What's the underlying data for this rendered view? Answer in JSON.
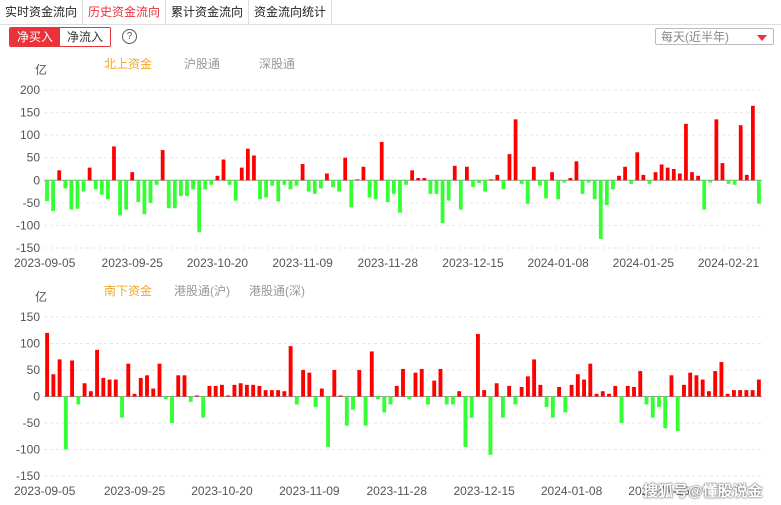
{
  "tabs": [
    "实时资金流向",
    "历史资金流向",
    "累计资金流向",
    "资金流向统计"
  ],
  "active_tab": 1,
  "toggle": {
    "on": "净买入",
    "off": "净流入"
  },
  "help_label": "?",
  "period_select": "每天(近半年)",
  "watermark": "搜狐号@懂股说金",
  "colors": {
    "positive": "#ff0000",
    "negative": "#33ff33",
    "active_legend": "#f5a623",
    "inactive_legend": "#999999",
    "tab_active": "#e8333a"
  },
  "chart_data": [
    {
      "type": "bar",
      "unit_label": "亿",
      "legend": [
        "北上资金",
        "沪股通",
        "深股通"
      ],
      "legend_active": 0,
      "ylim": [
        -150,
        200
      ],
      "yticks": [
        -150,
        -100,
        -50,
        0,
        50,
        100,
        150,
        200
      ],
      "xtick_labels": [
        "2023-09-05",
        "2023-09-25",
        "2023-10-20",
        "2023-11-09",
        "2023-11-28",
        "2023-12-15",
        "2024-01-08",
        "2024-01-25",
        "2024-02-21"
      ],
      "xtick_positions": [
        0,
        14,
        28,
        42,
        56,
        70,
        84,
        98,
        112
      ],
      "values": [
        -46,
        -68,
        22,
        -18,
        -65,
        -63,
        -25,
        28,
        -20,
        -32,
        -42,
        75,
        -78,
        -65,
        18,
        -48,
        -75,
        -50,
        -10,
        67,
        -62,
        -62,
        -35,
        -35,
        -20,
        -115,
        -20,
        -10,
        10,
        46,
        -10,
        -45,
        28,
        70,
        55,
        -42,
        -38,
        -12,
        -47,
        -10,
        -20,
        -12,
        36,
        -25,
        -30,
        -18,
        15,
        -15,
        -25,
        50,
        -60,
        2,
        30,
        -38,
        -42,
        85,
        -48,
        -30,
        -72,
        -10,
        22,
        5,
        5,
        -30,
        -30,
        -95,
        -45,
        32,
        -65,
        30,
        -15,
        -6,
        -25,
        2,
        12,
        -20,
        58,
        135,
        -8,
        -52,
        30,
        -12,
        -40,
        18,
        -42,
        -5,
        5,
        42,
        -30,
        -5,
        -42,
        -130,
        -55,
        -20,
        10,
        30,
        -8,
        62,
        12,
        -8,
        18,
        35,
        28,
        25,
        15,
        125,
        18,
        10,
        -65,
        -5,
        135,
        38,
        -8,
        -10,
        122,
        12,
        165,
        -52
      ]
    },
    {
      "type": "bar",
      "unit_label": "亿",
      "legend": [
        "南下资金",
        "港股通(沪)",
        "港股通(深)"
      ],
      "legend_active": 0,
      "ylim": [
        -150,
        150
      ],
      "yticks": [
        -150,
        -100,
        -50,
        0,
        50,
        100,
        150
      ],
      "xtick_labels": [
        "2023-09-05",
        "2023-09-25",
        "2023-10-20",
        "2023-11-09",
        "2023-11-28",
        "2023-12-15",
        "2024-01-08",
        "2024-01-25"
      ],
      "xtick_positions": [
        0,
        14,
        28,
        42,
        56,
        70,
        84,
        98
      ],
      "values": [
        120,
        42,
        70,
        -100,
        68,
        -15,
        25,
        10,
        88,
        35,
        32,
        32,
        -40,
        62,
        5,
        35,
        40,
        15,
        62,
        -5,
        -50,
        40,
        40,
        -10,
        2,
        -40,
        20,
        20,
        22,
        2,
        22,
        25,
        22,
        22,
        20,
        12,
        12,
        12,
        10,
        95,
        -15,
        50,
        45,
        -20,
        15,
        -95,
        50,
        2,
        -55,
        -25,
        50,
        -55,
        85,
        -5,
        -30,
        -15,
        20,
        52,
        -5,
        45,
        52,
        -15,
        30,
        52,
        -15,
        -15,
        10,
        -95,
        -40,
        118,
        12,
        -110,
        25,
        -40,
        20,
        -15,
        18,
        38,
        70,
        22,
        -20,
        -40,
        18,
        -30,
        22,
        42,
        32,
        62,
        5,
        10,
        5,
        20,
        -50,
        20,
        18,
        48,
        -15,
        -40,
        -20,
        -60,
        40,
        -65,
        22,
        45,
        40,
        32,
        10,
        48,
        65,
        5,
        12,
        12,
        12,
        12,
        32
      ]
    }
  ]
}
